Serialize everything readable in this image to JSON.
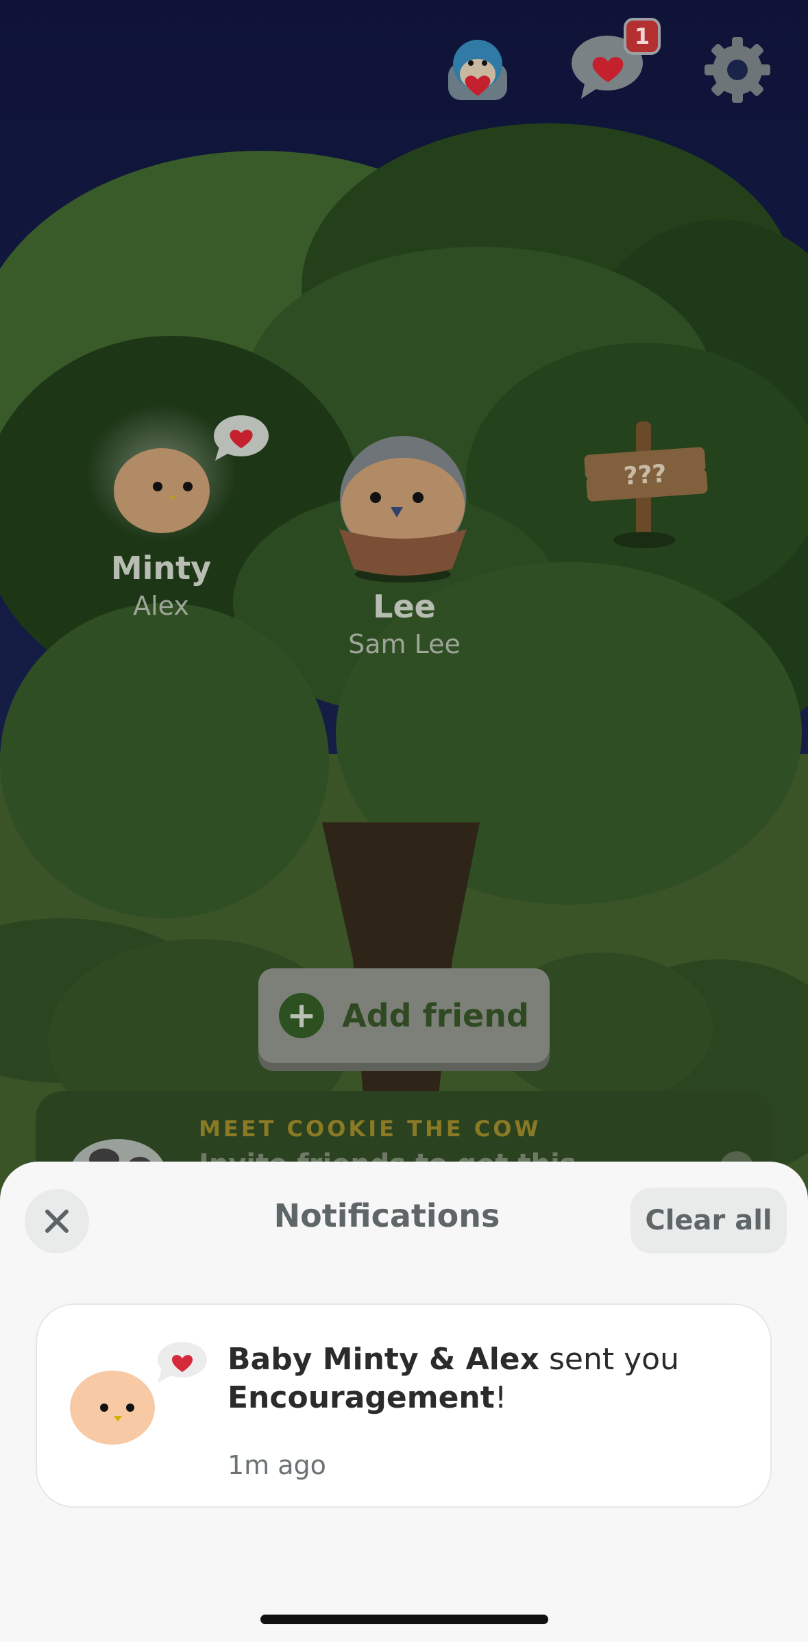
{
  "top_bar": {
    "notification_count": "1"
  },
  "sign": {
    "text": "???"
  },
  "friends": [
    {
      "name": "Minty",
      "owner": "Alex"
    },
    {
      "name": "Lee",
      "owner": "Sam Lee"
    }
  ],
  "add_friend": {
    "label": "Add friend"
  },
  "promo": {
    "title": "MEET COOKIE THE COW",
    "subtitle": "Invite friends to get this"
  },
  "notifications_sheet": {
    "title": "Notifications",
    "clear_all_label": "Clear all",
    "items": [
      {
        "sender": "Baby Minty & Alex",
        "middle": "sent you",
        "action": "Encouragement",
        "end": "!",
        "time": "1m ago"
      }
    ]
  },
  "colors": {
    "sky_top": "#0f1433",
    "foliage_dark": "#223a1a",
    "foliage_mid": "#2e4a22",
    "sheet_bg": "#f7f7f7",
    "heart": "#d42a3a",
    "badge": "#c0392b"
  }
}
